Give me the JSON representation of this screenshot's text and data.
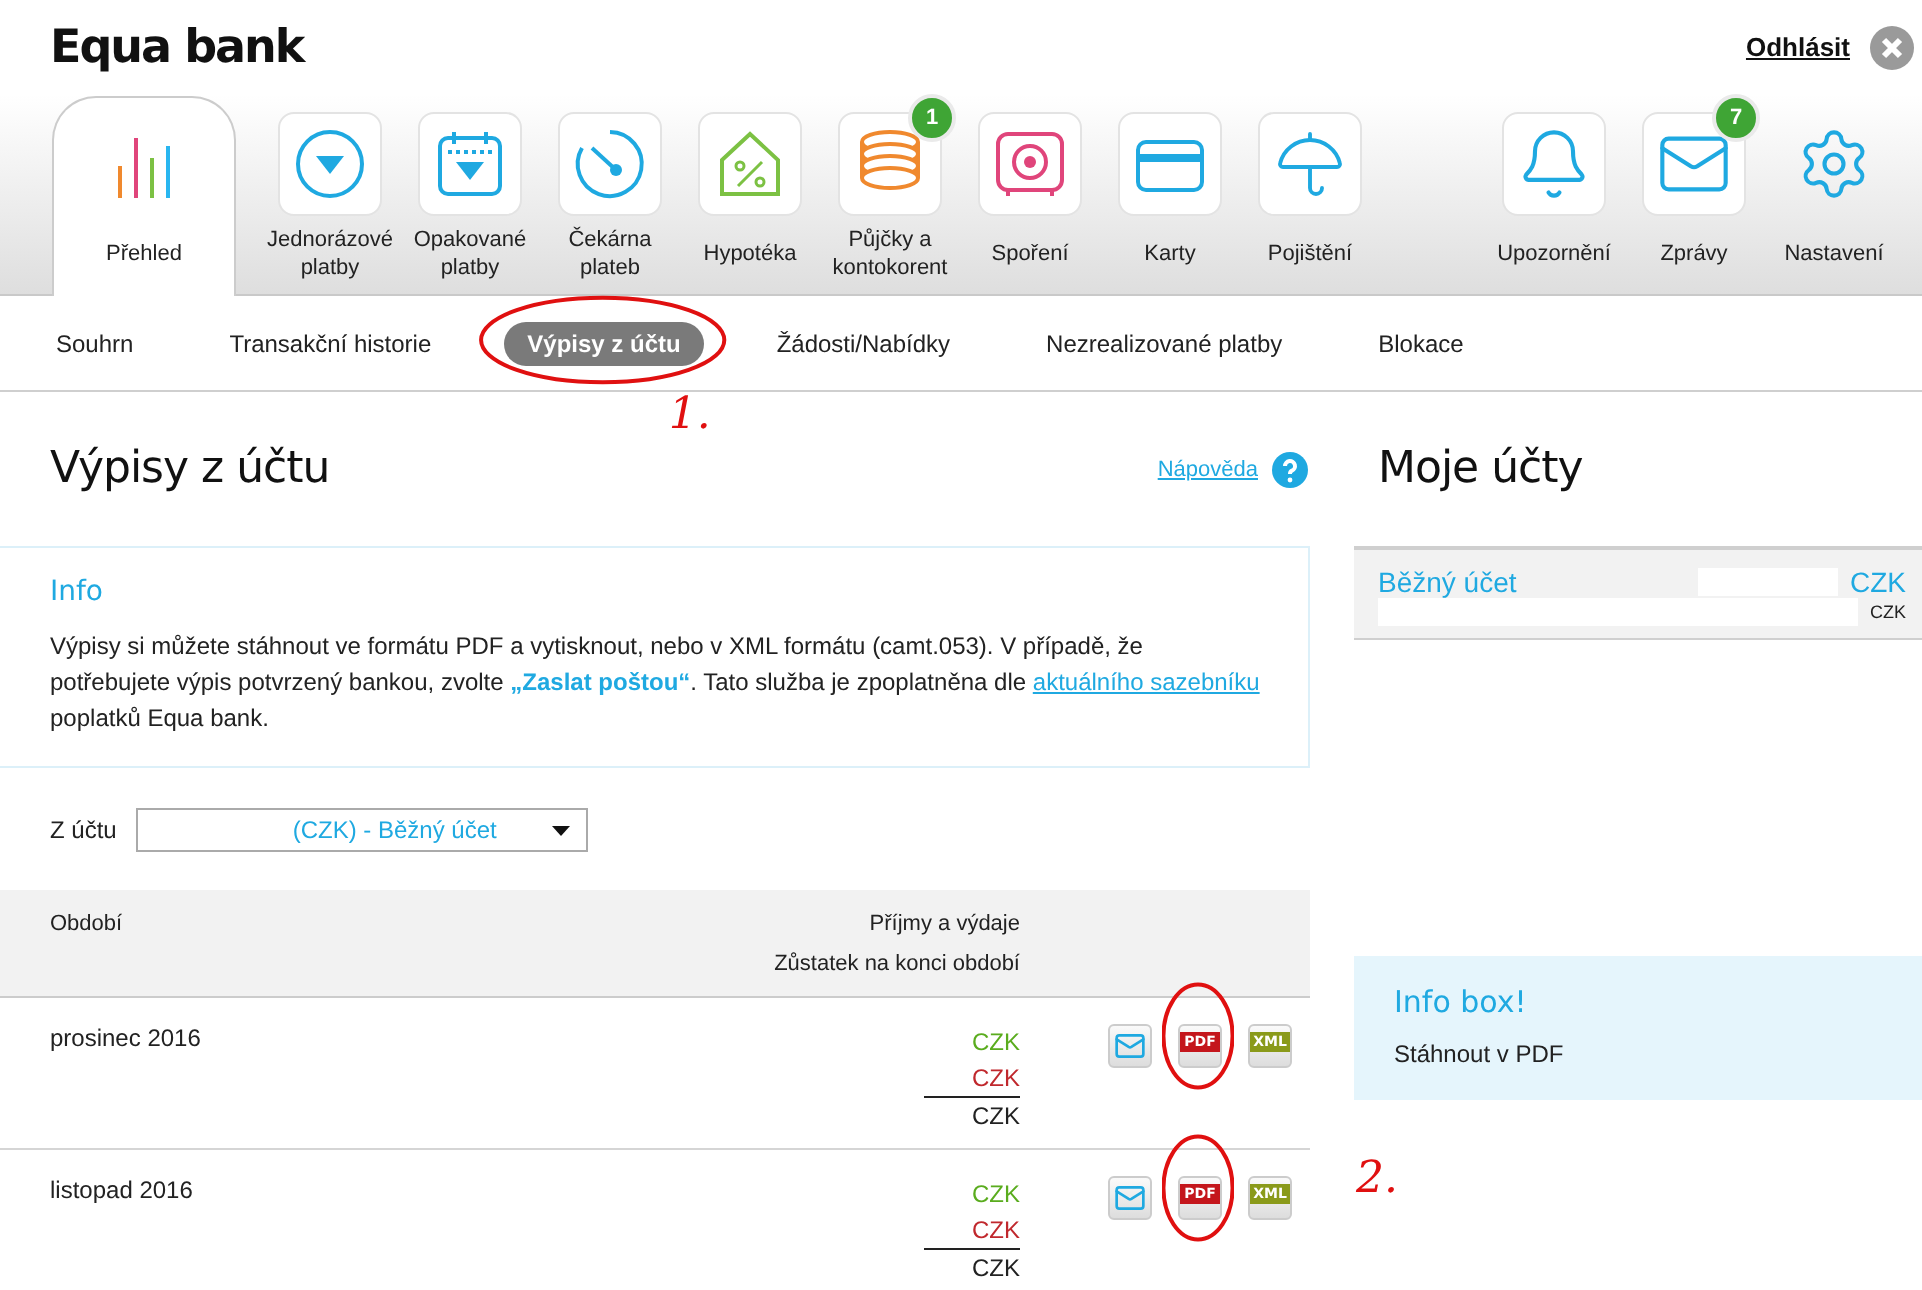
{
  "header": {
    "logo": "Equa bank",
    "logout": "Odhlásit"
  },
  "nav": {
    "main": [
      {
        "label": "Přehled",
        "selected": true,
        "framed": false
      },
      {
        "label": "Jednorázové platby",
        "selected": false,
        "framed": true
      },
      {
        "label": "Opakované platby",
        "selected": false,
        "framed": true
      },
      {
        "label": "Čekárna plateb",
        "selected": false,
        "framed": true
      },
      {
        "label": "Hypotéka",
        "selected": false,
        "framed": true
      },
      {
        "label": "Půjčky a kontokorent",
        "selected": false,
        "framed": true,
        "badge": "1"
      },
      {
        "label": "Spoření",
        "selected": false,
        "framed": true
      },
      {
        "label": "Karty",
        "selected": false,
        "framed": true
      },
      {
        "label": "Pojištění",
        "selected": false,
        "framed": true
      }
    ],
    "right": [
      {
        "label": "Upozornění",
        "selected": false,
        "framed": true
      },
      {
        "label": "Zprávy",
        "selected": false,
        "framed": true,
        "badge": "7"
      },
      {
        "label": "Nastavení",
        "selected": false,
        "framed": false
      }
    ]
  },
  "subtabs": [
    {
      "label": "Souhrn",
      "selected": false
    },
    {
      "label": "Transakční historie",
      "selected": false
    },
    {
      "label": "Výpisy z účtu",
      "selected": true,
      "circled": true,
      "note": "1."
    },
    {
      "label": "Žádosti/Nabídky",
      "selected": false
    },
    {
      "label": "Nezrealizované platby",
      "selected": false
    },
    {
      "label": "Blokace",
      "selected": false
    }
  ],
  "page": {
    "title": "Výpisy z účtu",
    "help": "Nápověda",
    "info": {
      "title": "Info",
      "parts": [
        {
          "kind": "text",
          "text": "Výpisy si můžete stáhnout ve formátu PDF a vytisknout, nebo v XML formátu (camt.053). V případě, že potřebujete výpis potvrzený bankou, zvolte "
        },
        {
          "kind": "emphasis",
          "text": "„Zaslat poštou“"
        },
        {
          "kind": "text",
          "text": ". Tato služba je zpoplatněna dle "
        },
        {
          "kind": "link",
          "text": "aktuálního sazebníku"
        },
        {
          "kind": "text",
          "text": " poplatků Equa bank."
        }
      ]
    },
    "account_select": {
      "label": "Z účtu",
      "value": "(CZK) - Běžný účet"
    },
    "table": {
      "columns": [
        "Období"
      ],
      "amount_headers": [
        "Příjmy a výdaje",
        "Zůstatek na konci období"
      ],
      "rows": [
        {
          "period": "prosinec 2016",
          "income": "CZK",
          "expense": "CZK",
          "balance": "CZK",
          "actions": [
            {
              "kind": "mail"
            },
            {
              "kind": "pdf",
              "label": "PDF",
              "circled": true
            },
            {
              "kind": "xml",
              "label": "XML",
              "circled": false
            }
          ]
        },
        {
          "period": "listopad 2016",
          "income": "CZK",
          "expense": "CZK",
          "balance": "CZK",
          "note": "2.",
          "actions": [
            {
              "kind": "mail"
            },
            {
              "kind": "pdf",
              "label": "PDF",
              "circled": true
            },
            {
              "kind": "xml",
              "label": "XML",
              "circled": false
            }
          ]
        }
      ]
    }
  },
  "sidebar": {
    "title": "Moje účty",
    "account": {
      "name": "Běžný účet",
      "currency": "CZK",
      "balance_currency": "CZK"
    },
    "info_box": {
      "title": "Info box!",
      "text": "Stáhnout v PDF"
    }
  }
}
